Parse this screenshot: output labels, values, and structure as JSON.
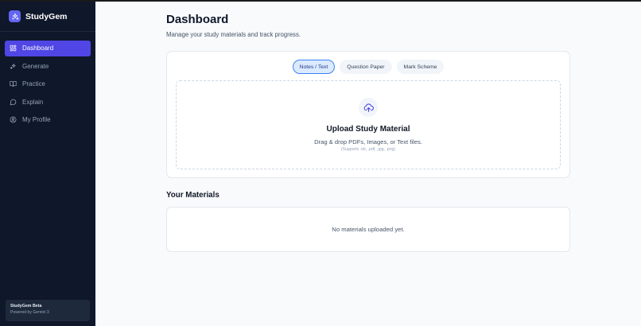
{
  "app": {
    "name": "StudyGem"
  },
  "sidebar": {
    "items": [
      {
        "label": "Dashboard",
        "icon": "dashboard-icon",
        "active": true
      },
      {
        "label": "Generate",
        "icon": "sparkles-icon",
        "active": false
      },
      {
        "label": "Practice",
        "icon": "book-icon",
        "active": false
      },
      {
        "label": "Explain",
        "icon": "chat-bubble-icon",
        "active": false
      },
      {
        "label": "My Profile",
        "icon": "user-circle-icon",
        "active": false
      }
    ],
    "footer": {
      "title": "StudyGem Beta",
      "subtitle": "Powered by Gemini 3"
    }
  },
  "header": {
    "title": "Dashboard",
    "subtitle": "Manage your study materials and track progress."
  },
  "upload": {
    "tabs": [
      {
        "label": "Notes / Text",
        "active": true
      },
      {
        "label": "Question Paper",
        "active": false
      },
      {
        "label": "Mark Scheme",
        "active": false
      }
    ],
    "title": "Upload Study Material",
    "description": "Drag & drop PDFs, Images, or Text files.",
    "hint": "(Supports .txt, .pdf, .jpg, .png)"
  },
  "materials": {
    "title": "Your Materials",
    "empty": "No materials uploaded yet."
  },
  "colors": {
    "sidebar_bg": "#0f172a",
    "accent": "#4f46e5",
    "tab_active_bg": "#dbeafe",
    "tab_active_border": "#3b82f6"
  }
}
